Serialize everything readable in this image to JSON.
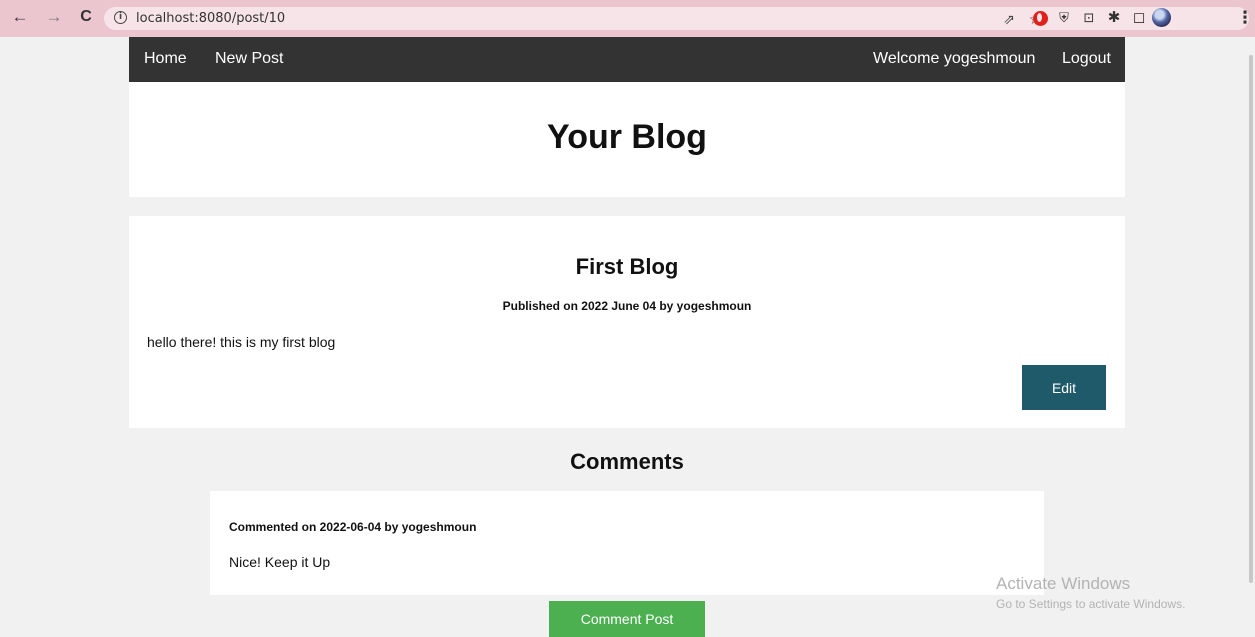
{
  "browser": {
    "url": "localhost:8080/post/10",
    "icons": {
      "back": "←",
      "forward": "→",
      "reload": "C",
      "info": "i",
      "share": "⇗",
      "star": "☆",
      "vpn": "⛨",
      "wallet": "⊡",
      "puzzle": "✱",
      "sidepanel": "◻",
      "menu": "⋮"
    }
  },
  "nav": {
    "home": "Home",
    "new_post": "New Post",
    "welcome": "Welcome yogeshmoun",
    "logout": "Logout"
  },
  "header": {
    "title": "Your Blog"
  },
  "post": {
    "title": "First Blog",
    "meta": "Published on 2022 June 04 by yogeshmoun",
    "body": "hello there! this is my first blog",
    "edit_label": "Edit"
  },
  "comments": {
    "heading": "Comments",
    "items": [
      {
        "meta": "Commented on 2022-06-04 by yogeshmoun",
        "body": "Nice! Keep it Up"
      }
    ],
    "button_label": "Comment Post"
  },
  "watermark": {
    "title": "Activate Windows",
    "subtitle": "Go to Settings to activate Windows."
  }
}
